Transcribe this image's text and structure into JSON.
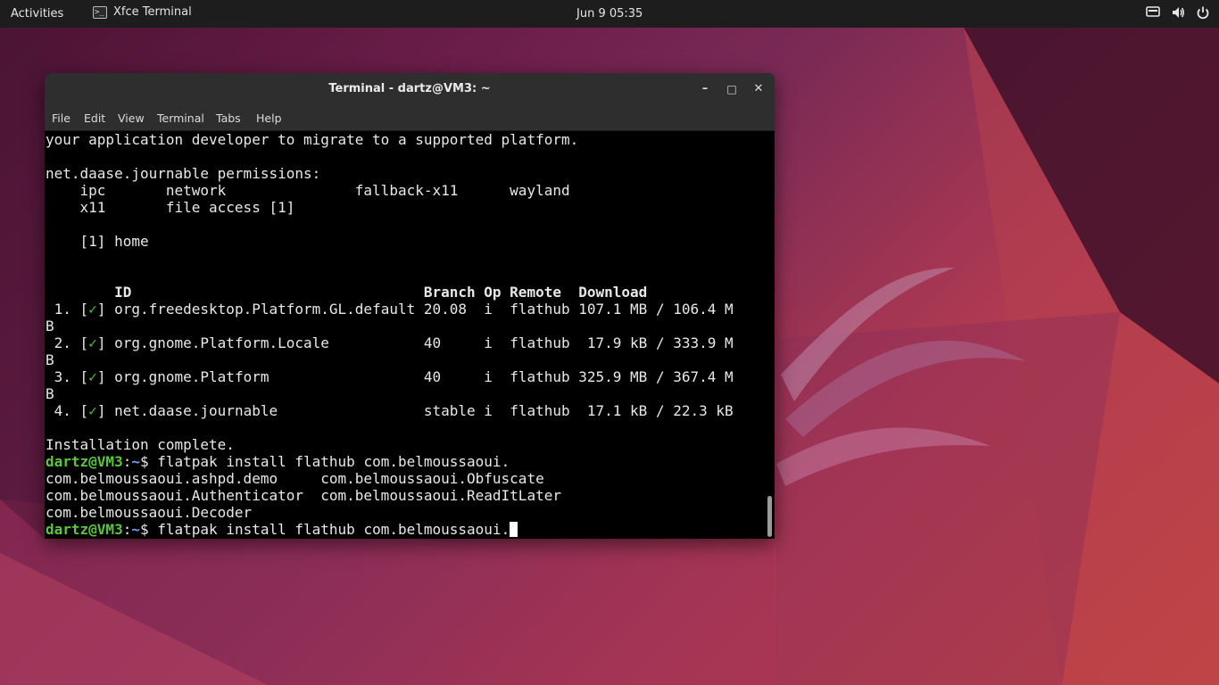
{
  "topbar": {
    "activities": "Activities",
    "app_name": "Xfce Terminal",
    "app_icon_glyph": ">_",
    "clock": "Jun 9  05:35",
    "tray": [
      "display-icon",
      "volume-icon",
      "power-icon"
    ]
  },
  "window": {
    "title": "Terminal - dartz@VM3: ~",
    "controls": {
      "minimize": "–",
      "maximize": "□",
      "close": "✕"
    },
    "menu": [
      "File",
      "Edit",
      "View",
      "Terminal",
      "Tabs",
      "Help"
    ]
  },
  "terminal": {
    "prompt_user": "dartz@VM3",
    "prompt_sep": ":",
    "prompt_dir": "~",
    "prompt_sym": "$ ",
    "lines": {
      "l1": "your application developer to migrate to a supported platform.",
      "l3": "net.daase.journable permissions:",
      "l4": "    ipc       network               fallback-x11      wayland",
      "l5": "    x11       file access [1]",
      "l7": "    [1] home",
      "l10": "        ID                                  Branch Op Remote  Download",
      "row1_num": " 1. [",
      "row1_check": "✓",
      "row1_rest": "] org.freedesktop.Platform.GL.default 20.08  i  flathub 107.1 MB / 106.4 M",
      "row1_wrap": "B",
      "row2_num": " 2. [",
      "row2_check": "✓",
      "row2_rest": "] org.gnome.Platform.Locale           40     i  flathub  17.9 kB / 333.9 M",
      "row2_wrap": "B",
      "row3_num": " 3. [",
      "row3_check": "✓",
      "row3_rest": "] org.gnome.Platform                  40     i  flathub 325.9 MB / 367.4 M",
      "row3_wrap": "B",
      "row4_num": " 4. [",
      "row4_check": "✓",
      "row4_rest": "] net.daase.journable                 stable i  flathub  17.1 kB / 22.3 kB",
      "l20": "Installation complete.",
      "cmd1": "flatpak install flathub com.belmoussaoui.",
      "l22": "com.belmoussaoui.ashpd.demo     com.belmoussaoui.Obfuscate",
      "l23": "com.belmoussaoui.Authenticator  com.belmoussaoui.ReadItLater",
      "l24": "com.belmoussaoui.Decoder",
      "cmd2": "flatpak install flathub com.belmoussaoui."
    }
  }
}
